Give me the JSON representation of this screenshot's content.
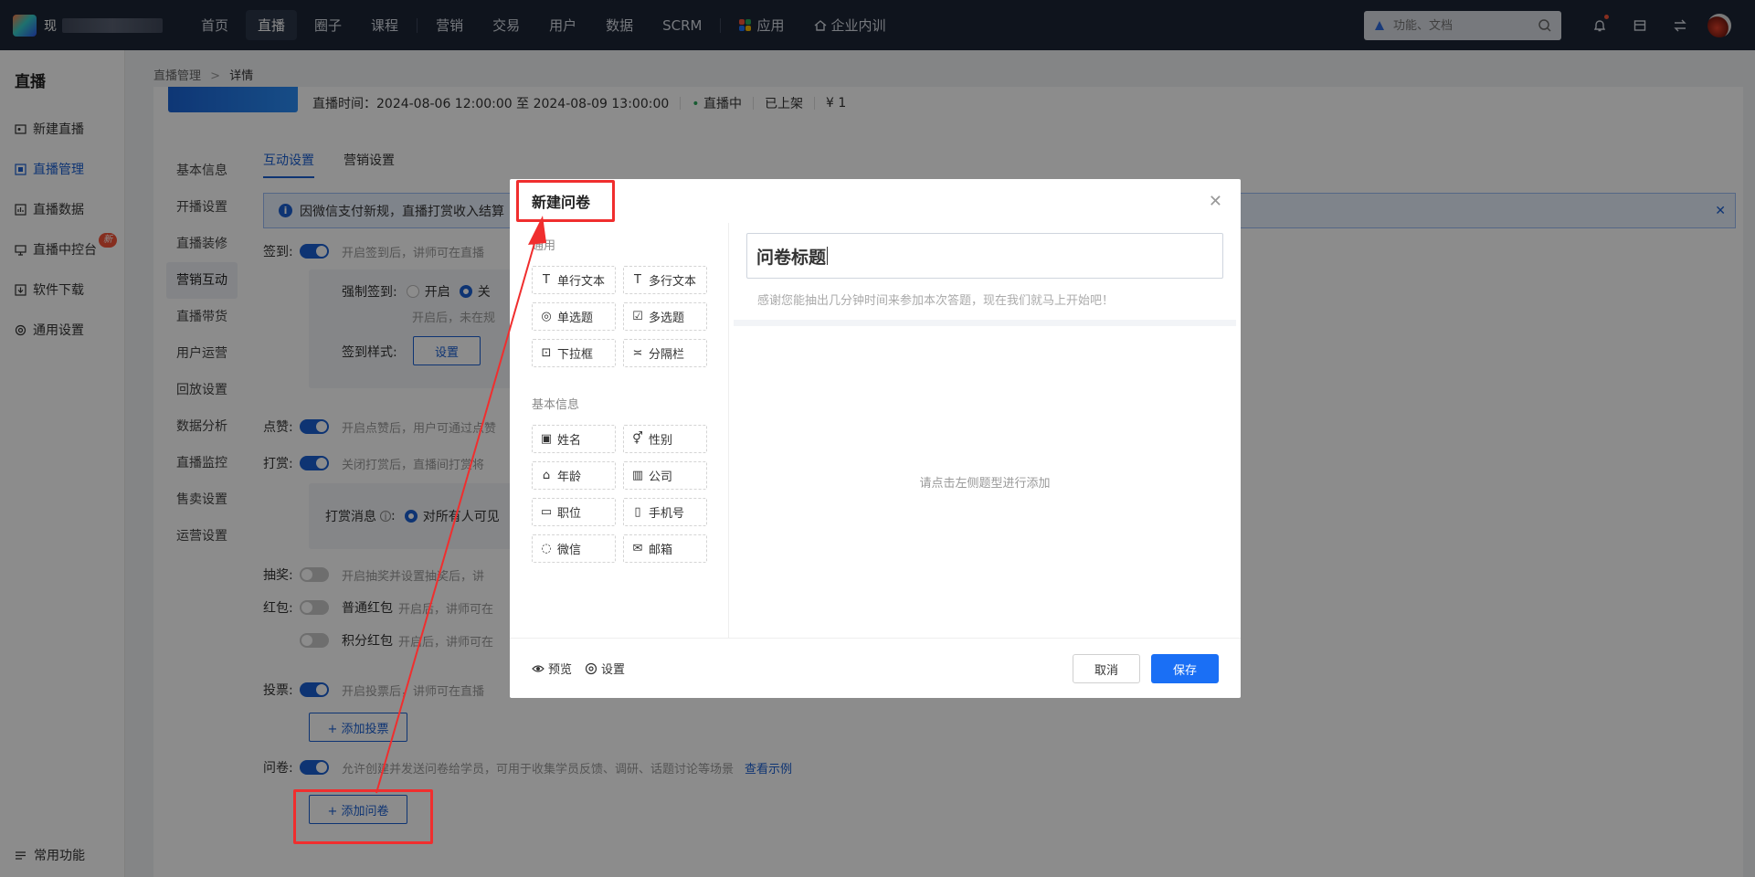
{
  "topbar": {
    "app_name": "现",
    "nav": [
      "首页",
      "直播",
      "圈子",
      "课程",
      "营销",
      "交易",
      "用户",
      "数据",
      "SCRM",
      "应用",
      "企业内训"
    ],
    "search_placeholder": "功能、文档"
  },
  "sidebar": {
    "title": "直播",
    "items": [
      "新建直播",
      "直播管理",
      "直播数据",
      "直播中控台",
      "软件下载",
      "通用设置"
    ],
    "badge": "新",
    "bottom": "常用功能"
  },
  "breadcrumb": {
    "parent": "直播管理",
    "sep": ">",
    "current": "详情"
  },
  "live_info": {
    "time": "直播时间：2024-08-06 12:00:00 至 2024-08-09 13:00:00",
    "status": "直播中",
    "shelf": "已上架",
    "price": "¥ 1"
  },
  "submenu": [
    "基本信息",
    "开播设置",
    "直播装修",
    "营销互动",
    "直播带货",
    "用户运营",
    "回放设置",
    "数据分析",
    "直播监控",
    "售卖设置",
    "运营设置"
  ],
  "tabs": [
    "互动设置",
    "营销设置"
  ],
  "notice": "因微信支付新规，直播打赏收入结算",
  "settings": {
    "checkin": {
      "label": "签到:",
      "desc": "开启签到后，讲师可在直播"
    },
    "force_checkin": {
      "label": "强制签到:",
      "on": "开启",
      "off": "关"
    },
    "force_desc": "开启后，未在规",
    "checkin_style": {
      "label": "签到样式:",
      "button": "设置"
    },
    "like": {
      "label": "点赞:",
      "desc": "开启点赞后，用户可通过点赞"
    },
    "reward": {
      "label": "打赏:",
      "desc": "关闭打赏后，直播间打赏将"
    },
    "reward_msg": {
      "label": "打赏消息",
      "option": "对所有人可见"
    },
    "lottery": {
      "label": "抽奖:",
      "desc": "开启抽奖并设置抽奖后，讲"
    },
    "redpacket": {
      "label": "红包:",
      "normal": "普通红包",
      "normal_desc": "开启后，讲师可在",
      "points": "积分红包",
      "points_desc": "开启后，讲师可在"
    },
    "vote": {
      "label": "投票:",
      "desc": "开启投票后，讲师可在直播",
      "button": "+ 添加投票"
    },
    "survey": {
      "label": "问卷:",
      "desc": "允许创建并发送问卷给学员，可用于收集学员反馈、调研、话题讨论等场景",
      "link": "查看示例",
      "button": "+ 添加问卷"
    }
  },
  "modal": {
    "title": "新建问卷",
    "groups": [
      {
        "name": "通用",
        "fields": [
          "单行文本",
          "多行文本",
          "单选题",
          "多选题",
          "下拉框",
          "分隔栏"
        ]
      },
      {
        "name": "基本信息",
        "fields": [
          "姓名",
          "性别",
          "年龄",
          "公司",
          "职位",
          "手机号",
          "微信",
          "邮箱"
        ]
      }
    ],
    "survey_title": "问卷标题",
    "survey_subtitle": "感谢您能抽出几分钟时间来参加本次答题，现在我们就马上开始吧！",
    "empty_hint": "请点击左侧题型进行添加",
    "preview": "预览",
    "settings": "设置",
    "cancel": "取消",
    "save": "保存"
  },
  "colors": {
    "primary": "#1a5fd1",
    "annotation": "#f02e2e",
    "topbar": "#1d2535"
  }
}
